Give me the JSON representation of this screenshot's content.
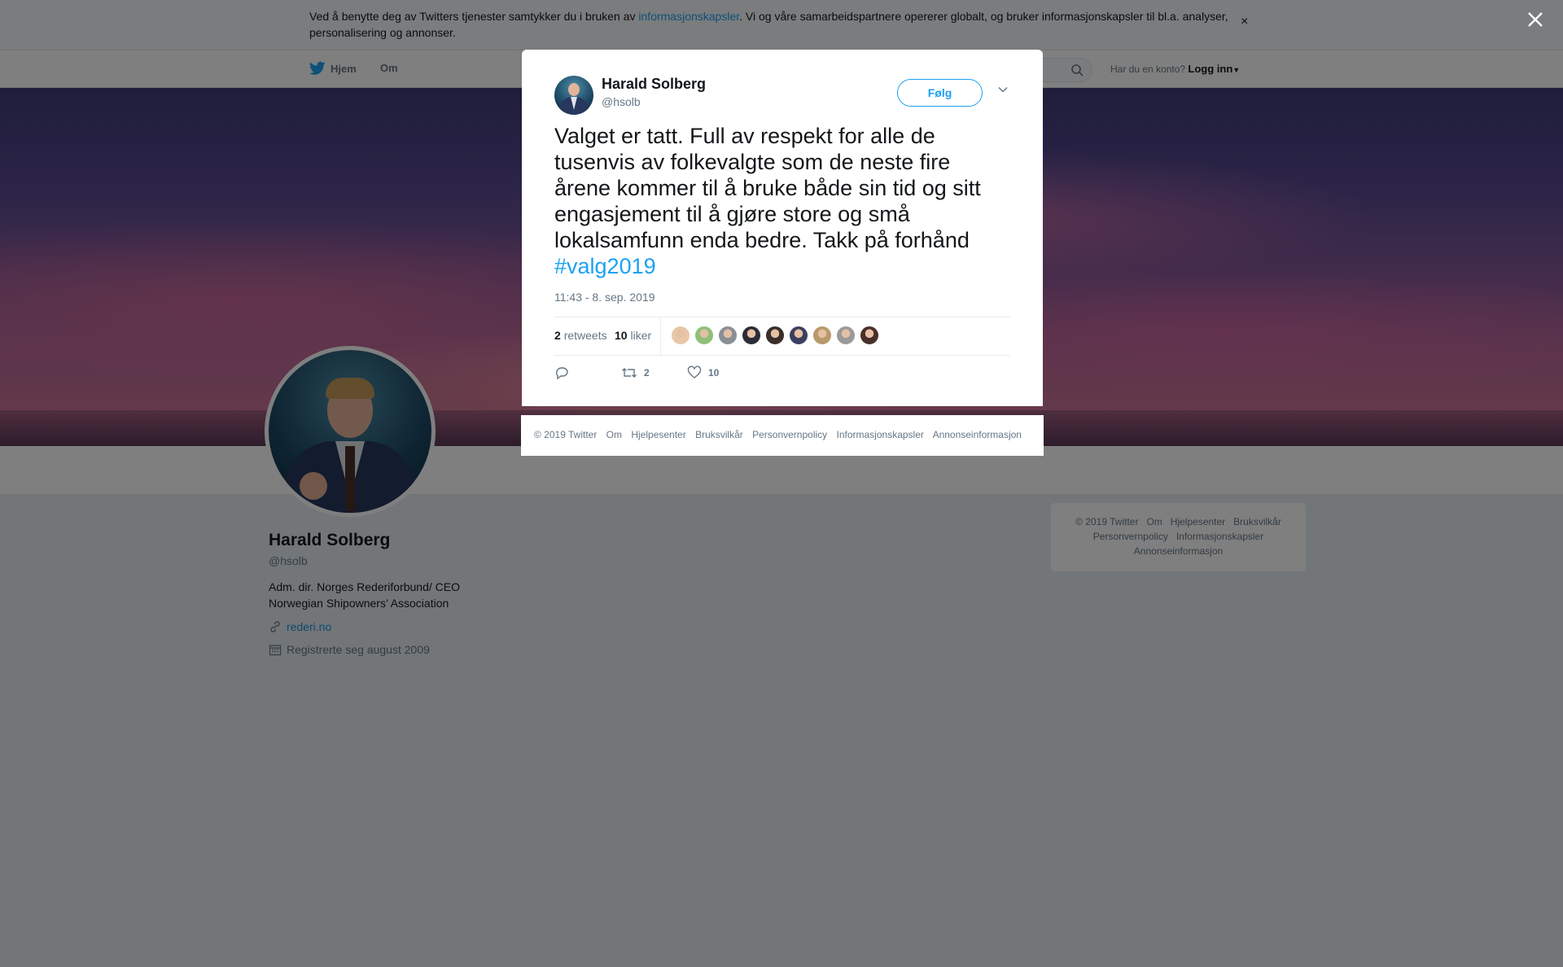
{
  "cookie_bar": {
    "text_before": "Ved å benytte deg av Twitters tjenester samtykker du i bruken av ",
    "link": "informasjonskapsler",
    "text_after": ". Vi og våre samarbeidspartnere opererer globalt, og bruker informasjonskapsler til bl.a. analyser, personalisering og annonser.",
    "close": "×"
  },
  "nav": {
    "home": "Hjem",
    "about": "Om",
    "account_prompt": "Har du en konto?",
    "login": "Logg inn"
  },
  "profile": {
    "name": "Harald Solberg",
    "handle": "@hsolb",
    "bio": "Adm. dir. Norges Rederiforbund/ CEO Norwegian Shipowners’ Association",
    "url": "rederi.no",
    "joined": "Registrerte seg august 2009"
  },
  "sidebar_footer": {
    "line1": [
      "© 2019 Twitter",
      "Om",
      "Hjelpesenter",
      "Bruksvilkår"
    ],
    "line2": [
      "Personvernpolicy",
      "Informasjonskapsler"
    ],
    "line3": [
      "Annonseinformasjon"
    ]
  },
  "tweet": {
    "name": "Harald Solberg",
    "handle": "@hsolb",
    "follow_label": "Følg",
    "text": "Valget er tatt. Full av respekt for alle de tusenvis av folkevalgte som de neste fire årene kommer til å bruke både sin tid og sitt engasjement til å gjøre store og små lokalsamfunn enda bedre. Takk på forhånd ",
    "hashtag": "#valg2019",
    "timestamp": "11:43 - 8. sep. 2019",
    "retweets_count": "2",
    "retweets_label": "retweets",
    "likes_count": "10",
    "likes_label": "liker",
    "action_retweet_count": "2",
    "action_like_count": "10",
    "liker_avatar_colors": [
      "#e8c7a8",
      "#8fbf7a",
      "#8a8f96",
      "#2b2b35",
      "#3a2f2a",
      "#3b4060",
      "#b89a6a",
      "#9a9a9a",
      "#4a2f2a"
    ]
  },
  "modal_footer": [
    "© 2019 Twitter",
    "Om",
    "Hjelpesenter",
    "Bruksvilkår",
    "Personvernpolicy",
    "Informasjonskapsler",
    "Annonseinformasjon"
  ]
}
